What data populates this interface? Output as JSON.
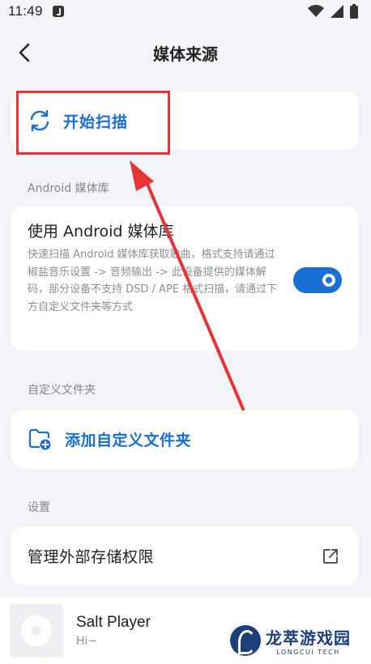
{
  "status_bar": {
    "time": "11:49",
    "icons": [
      "wifi-icon",
      "signal-icon",
      "battery-icon"
    ]
  },
  "app_bar": {
    "title": "媒体来源",
    "back_icon": "chevron-left-icon"
  },
  "scan": {
    "label": "开始扫描",
    "icon": "refresh-icon"
  },
  "android_section": {
    "header": "Android 媒体库",
    "title": "使用 Android 媒体库",
    "description": "快速扫描 Android 媒体库获取歌曲，格式支持请通过椒盐音乐设置 -> 音频输出 -> 此设备提供的媒体解码，部分设备不支持 DSD / APE 格式扫描，请通过下方自定义文件夹等方式",
    "toggle_on": true
  },
  "folder_section": {
    "header": "自定义文件夹",
    "add_label": "添加自定义文件夹",
    "icon": "folder-add-icon"
  },
  "settings_section": {
    "header": "设置",
    "storage_label": "管理外部存储权限",
    "icon": "external-link-icon"
  },
  "player": {
    "title": "Salt Player",
    "subtitle": "Hi~"
  },
  "watermark": {
    "title": "龙萃游戏园",
    "subtitle": "LONGCUI TECH"
  },
  "colors": {
    "accent": "#1a6fd4",
    "background": "#f3f4f8",
    "highlight": "#e53535"
  }
}
